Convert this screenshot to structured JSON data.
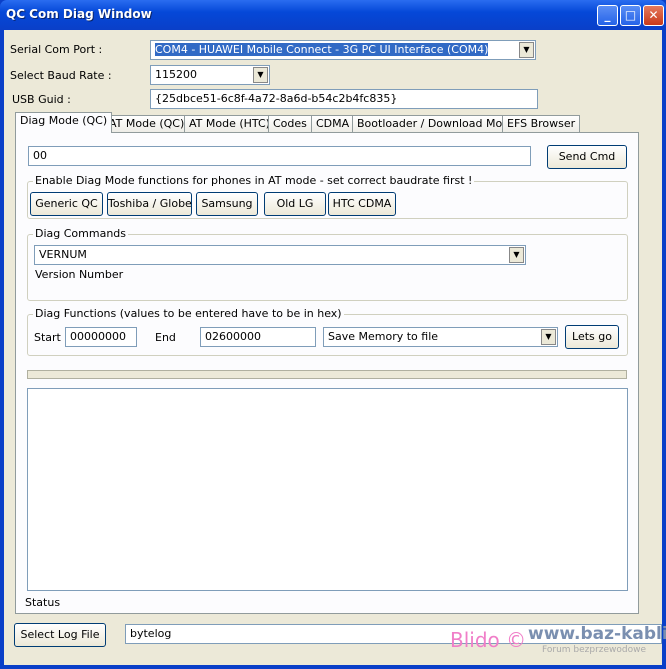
{
  "window": {
    "title": "QC Com Diag Window",
    "minimize": "_",
    "maximize": "□",
    "close": "✕"
  },
  "top": {
    "serial_label": "Serial Com Port :",
    "serial_value": "COM4 - HUAWEI Mobile Connect - 3G PC UI Interface (COM4)",
    "baud_label": "Select Baud Rate :",
    "baud_value": "115200",
    "guid_label": "USB Guid :",
    "guid_value": "{25dbce51-6c8f-4a72-8a6d-b54c2b4fc835}"
  },
  "tabs": [
    "Diag Mode (QC)",
    "AT Mode (QC)",
    "AT Mode (HTC)",
    "Codes",
    "CDMA",
    "Bootloader / Download Mode",
    "EFS Browser"
  ],
  "diag": {
    "cmd_value": "00",
    "send_label": "Send Cmd",
    "enable_title": "Enable Diag Mode functions for phones in AT mode - set correct baudrate first !",
    "enable_buttons": [
      "Generic QC",
      "Toshiba / Globe",
      "Samsung",
      "Old LG",
      "HTC CDMA"
    ],
    "commands_title": "Diag Commands",
    "command_value": "VERNUM",
    "command_desc": "Version Number",
    "functions_title": "Diag Functions (values to be entered have to be in hex)",
    "start_label": "Start",
    "start_value": "00000000",
    "end_label": "End",
    "end_value": "02600000",
    "function_value": "Save Memory to file",
    "go_label": "Lets go",
    "output": "",
    "status_label": "Status"
  },
  "bottom": {
    "log_button": "Select Log File",
    "log_value": "bytelog"
  },
  "watermark": {
    "text": "Blido ©",
    "site": "www.baz-kabli.pl",
    "sub": "Forum bezprzewodowe"
  }
}
